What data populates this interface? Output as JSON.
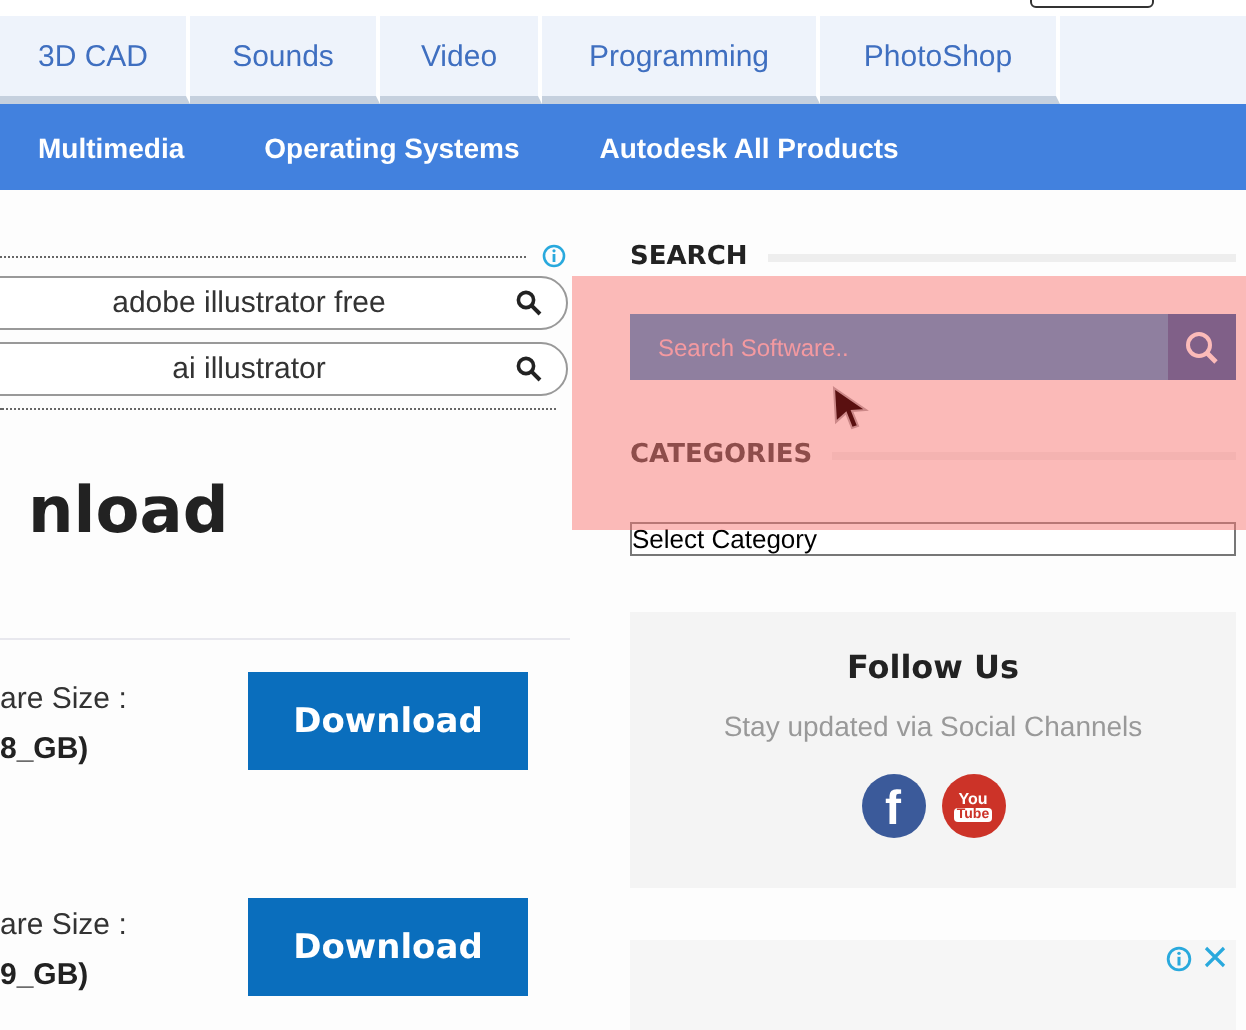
{
  "tabs": [
    {
      "label": "3D CAD"
    },
    {
      "label": "Sounds"
    },
    {
      "label": "Video"
    },
    {
      "label": "Programming"
    },
    {
      "label": "PhotoShop"
    }
  ],
  "nav": [
    "Multimedia",
    "Operating Systems",
    "Autodesk All Products"
  ],
  "related_searches": [
    "adobe illustrator free",
    "ai illustrator"
  ],
  "heading": "nload",
  "downloads": [
    {
      "label": "are Size :",
      "size": "8_GB)",
      "button": "Download"
    },
    {
      "label": "are Size :",
      "size": "9_GB)",
      "button": "Download"
    }
  ],
  "sidebar": {
    "search_title": "SEARCH",
    "search_placeholder": "Search Software..",
    "categories_title": "CATEGORIES",
    "category_select": "Select Category",
    "follow": {
      "title": "Follow Us",
      "subtitle": "Stay updated via Social Channels",
      "social": [
        {
          "kind": "facebook",
          "glyph": "f"
        },
        {
          "kind": "youtube",
          "glyph": "You",
          "glyph2": "Tube"
        }
      ]
    }
  }
}
